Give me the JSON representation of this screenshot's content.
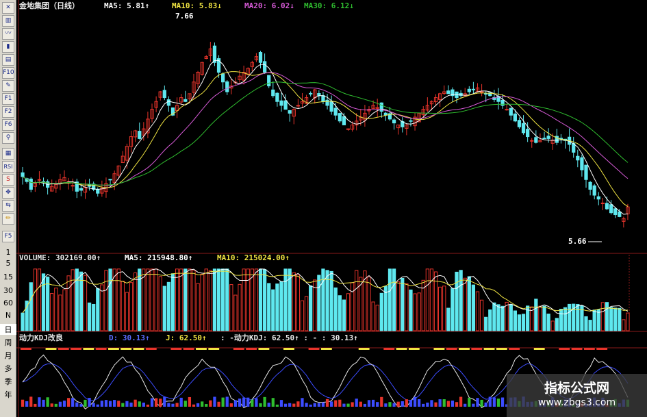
{
  "stock": {
    "name": "金地集团（日线）",
    "ma5_label": "MA5: 5.81↑",
    "ma10_label": "MA10: 5.83↓",
    "ma20_label": "MA20: 6.02↓",
    "ma30_label": "MA30: 6.12↓",
    "high_label": "7.66",
    "low_label": "5.66",
    "colors": {
      "up": "#e8342b",
      "down": "#5fe8ef",
      "ma5": "#ffffff",
      "ma10": "#f0e442",
      "ma20": "#d65ad6",
      "ma30": "#2fbd2f"
    }
  },
  "volume": {
    "label": "VOLUME: 302169.00↑",
    "ma5_label": "MA5: 215948.80↑",
    "ma10_label": "MA10: 215024.00↑"
  },
  "kdj": {
    "title": "动力KDJ改良",
    "d_label": "D: 30.13↑",
    "j_label": "J: 62.50↑",
    "extra_label": ": -动力KDJ: 62.50↑ : - : 30.13↑"
  },
  "toolbar": {
    "buttons": [
      "F10",
      "F1",
      "F2",
      "F6",
      "RSI",
      "S"
    ],
    "numbers": [
      "5",
      "15",
      "30",
      "60",
      "N"
    ],
    "periods": [
      "日",
      "周",
      "月",
      "多",
      "季",
      "年"
    ]
  },
  "brand": {
    "title": "指标公式网",
    "url": "www.zbgs3.com"
  },
  "chart_data": [
    {
      "type": "candlestick",
      "title": "金地集团（日线）",
      "ylim": [
        5.4,
        7.8
      ],
      "annotations": [
        {
          "text": "7.66",
          "value": 7.66
        },
        {
          "text": "5.66",
          "value": 5.66
        }
      ],
      "close": [
        6.13,
        6.08,
        6.0,
        6.06,
        6.1,
        6.07,
        6.02,
        6.03,
        6.05,
        6.1,
        6.12,
        6.08,
        6.04,
        5.98,
        5.99,
        6.02,
        6.03,
        6.0,
        5.96,
        6.01,
        6.06,
        6.1,
        6.16,
        6.24,
        6.34,
        6.44,
        6.54,
        6.6,
        6.52,
        6.62,
        6.72,
        6.82,
        6.9,
        7.0,
        6.94,
        6.86,
        6.76,
        6.86,
        6.94,
        6.9,
        6.98,
        7.1,
        7.2,
        7.3,
        7.36,
        7.44,
        7.3,
        7.2,
        7.1,
        7.0,
        7.06,
        7.1,
        7.16,
        7.2,
        7.24,
        7.3,
        7.36,
        7.3,
        7.2,
        7.06,
        6.96,
        6.9,
        6.86,
        6.82,
        6.78,
        6.82,
        6.86,
        6.9,
        6.94,
        6.98,
        7.02,
        6.96,
        6.9,
        6.86,
        6.8,
        6.76,
        6.7,
        6.66,
        6.62,
        6.66,
        6.7,
        6.74,
        6.78,
        6.82,
        6.86,
        6.84,
        6.8,
        6.76,
        6.72,
        6.68,
        6.66,
        6.64,
        6.66,
        6.7,
        6.74,
        6.78,
        6.82,
        6.86,
        6.9,
        6.94,
        6.98,
        7.0,
        6.98,
        6.96,
        6.94,
        6.96,
        6.98,
        7.0,
        7.02,
        7.04,
        7.0,
        6.98,
        6.96,
        6.92,
        6.9,
        6.86,
        6.82,
        6.76,
        6.7,
        6.64,
        6.58,
        6.54,
        6.5,
        6.48,
        6.5,
        6.52,
        6.52,
        6.5,
        6.48,
        6.52,
        6.5,
        6.46,
        6.38,
        6.3,
        6.2,
        6.1,
        6.0,
        5.94,
        5.9,
        5.86,
        5.8,
        5.76,
        5.74,
        5.72,
        5.7,
        5.82
      ]
    }
  ]
}
